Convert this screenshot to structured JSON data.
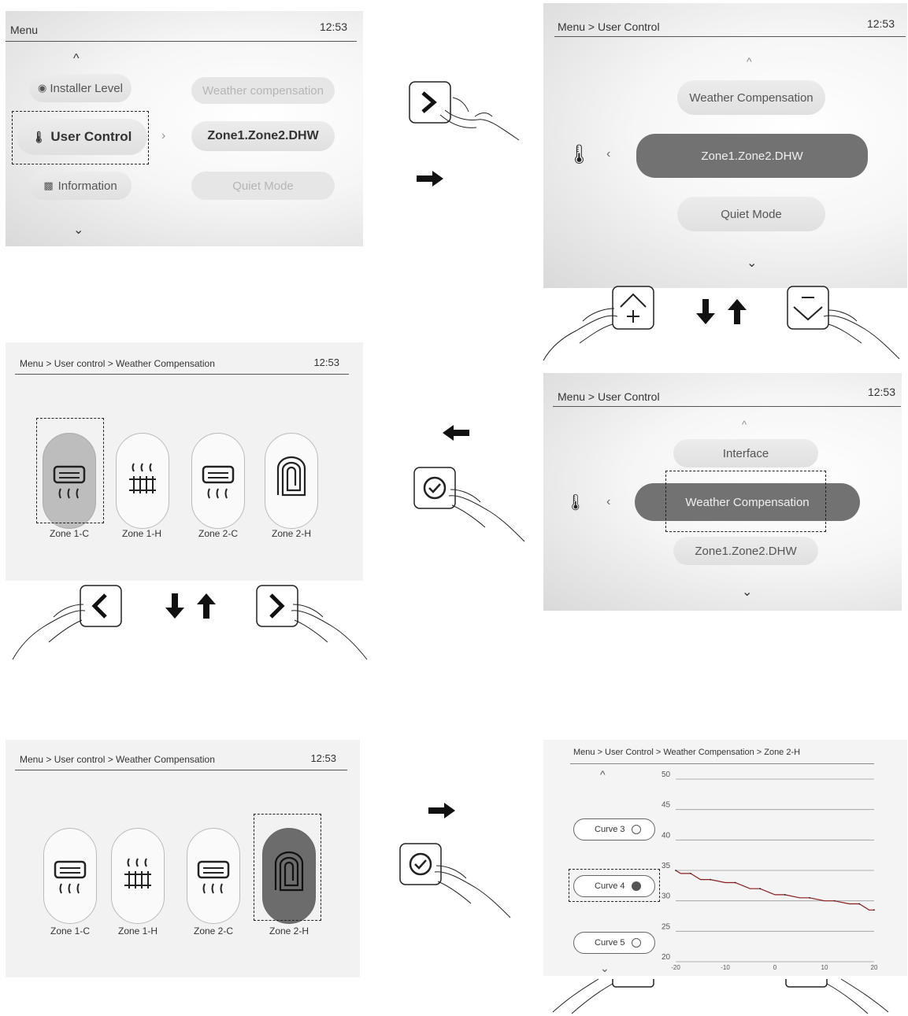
{
  "time": "12:53",
  "panel1": {
    "breadcrumb": "Menu",
    "left_items": [
      "Installer Level",
      "User Control",
      "Information"
    ],
    "right_items": [
      "Weather compensation",
      "Zone1.Zone2.DHW",
      "Quiet Mode"
    ]
  },
  "panel2": {
    "breadcrumb": "Menu > User Control",
    "items": [
      "Weather Compensation",
      "Zone1.Zone2.DHW",
      "Quiet Mode"
    ]
  },
  "panel3": {
    "breadcrumb": "Menu > User control > Weather Compensation",
    "zones": [
      "Zone 1-C",
      "Zone 1-H",
      "Zone 2-C",
      "Zone 2-H"
    ]
  },
  "panel4": {
    "breadcrumb": "Menu > User Control",
    "items": [
      "Interface",
      "Weather Compensation",
      "Zone1.Zone2.DHW"
    ]
  },
  "panel5": {
    "breadcrumb": "Menu > User control > Weather Compensation",
    "zones": [
      "Zone 1-C",
      "Zone 1-H",
      "Zone 2-C",
      "Zone 2-H"
    ]
  },
  "panel6": {
    "breadcrumb": "Menu > User Control > Weather Compensation > Zone 2-H",
    "curves": [
      "Curve 3",
      "Curve 4",
      "Curve 5"
    ],
    "selected_curve": "Curve 4"
  },
  "chart_data": {
    "type": "line",
    "title": "",
    "xlabel": "",
    "ylabel": "",
    "x_ticks": [
      "-20",
      "-10",
      "0",
      "10",
      "20"
    ],
    "y_ticks": [
      "50",
      "45",
      "40",
      "35",
      "30",
      "25",
      "20"
    ],
    "xlim": [
      -20,
      20
    ],
    "ylim": [
      20,
      50
    ],
    "grid": true,
    "x": [
      -20,
      -19,
      -17,
      -15,
      -13,
      -10,
      -8,
      -5,
      -3,
      0,
      2,
      5,
      7,
      10,
      12,
      15,
      17,
      19,
      20
    ],
    "y": [
      35,
      34.5,
      34.5,
      33.5,
      33.5,
      33,
      33,
      32,
      32,
      31,
      31,
      30.5,
      30.5,
      30,
      30,
      29.5,
      29.5,
      28.5,
      28.5
    ],
    "line_color": "#8b1a1a"
  },
  "colors": {
    "selected_pill": "#727272",
    "line": "#8b1a1a"
  }
}
